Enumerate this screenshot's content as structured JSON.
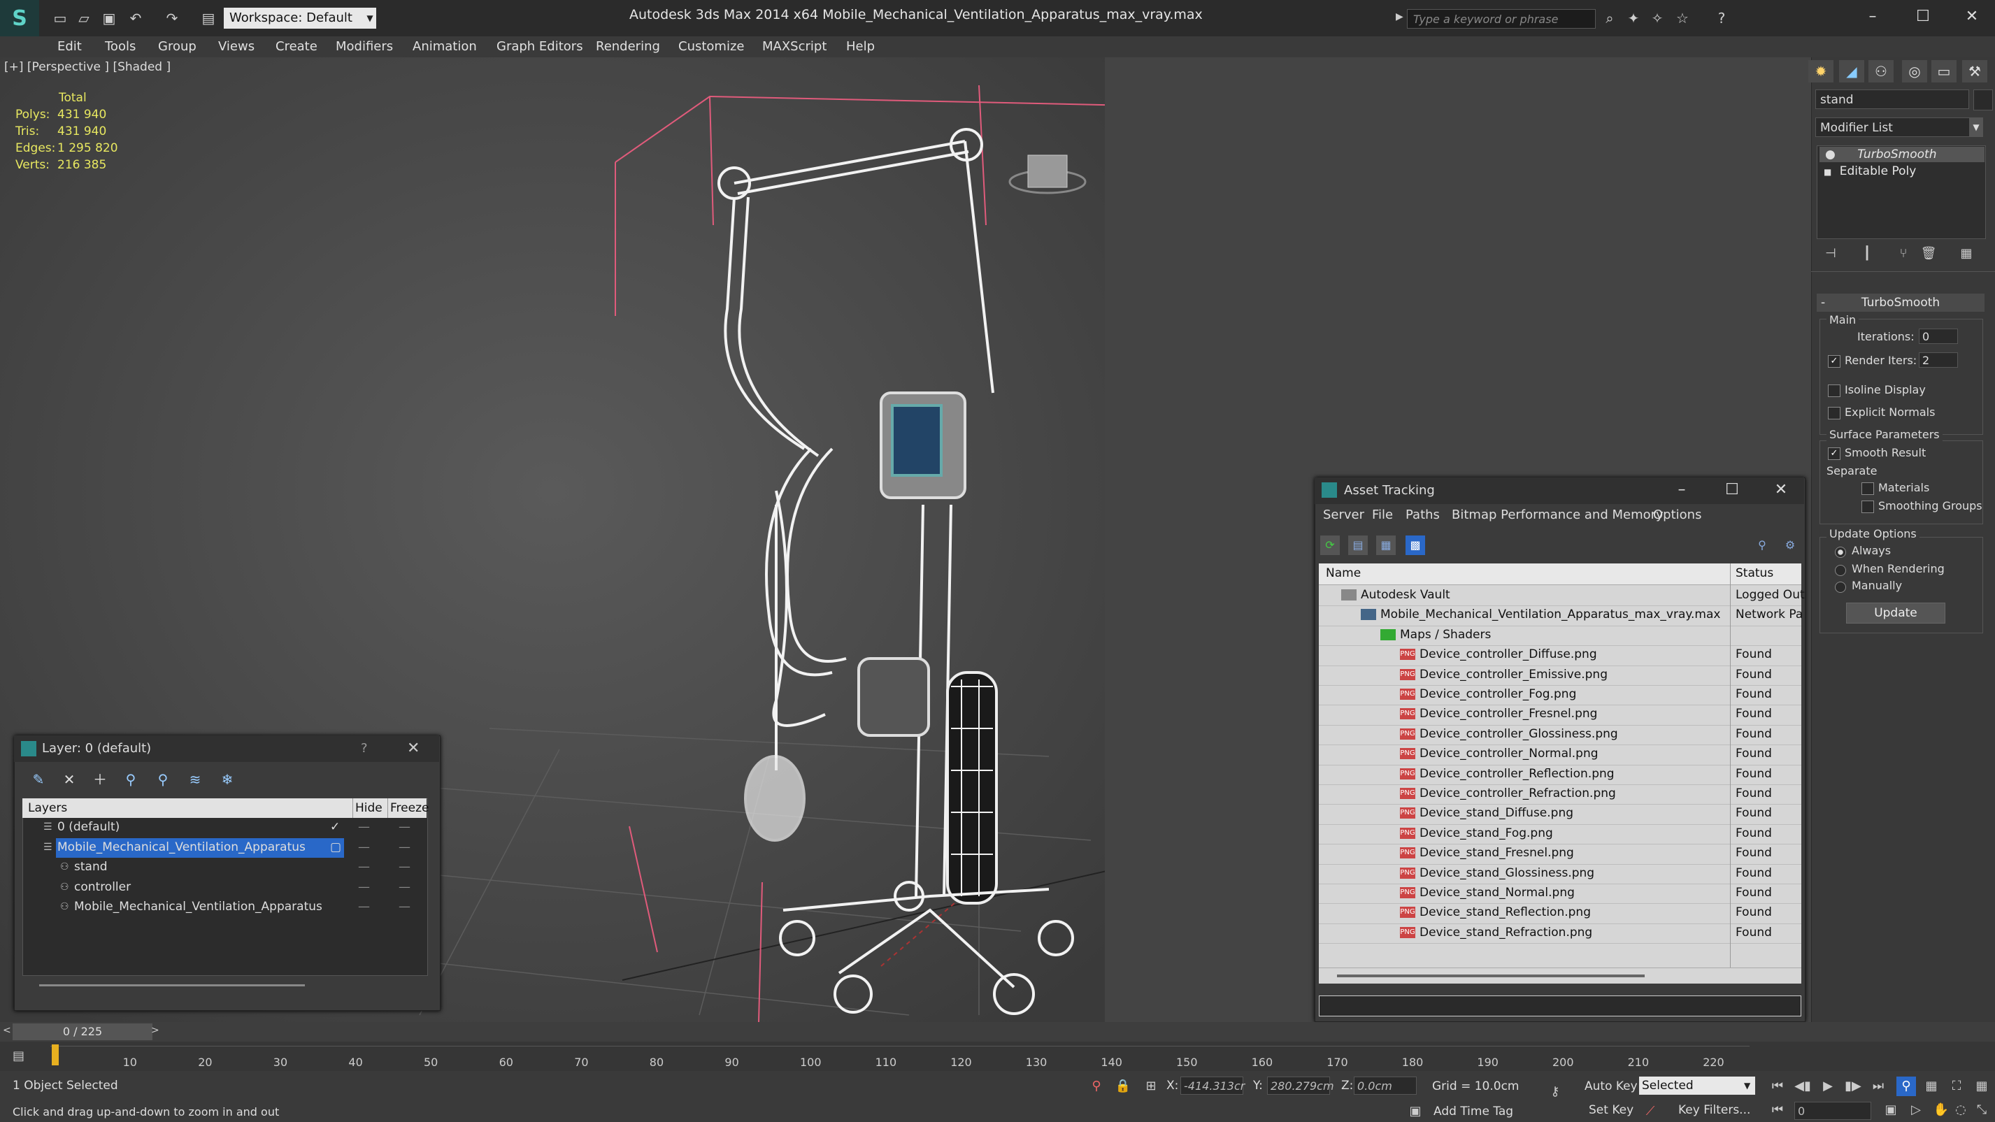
{
  "titlebar": {
    "workspace_label": "Workspace: Default",
    "app_title": "Autodesk 3ds Max  2014 x64     Mobile_Mechanical_Ventilation_Apparatus_max_vray.max",
    "search_placeholder": "Type a keyword or phrase"
  },
  "menu": [
    "Edit",
    "Tools",
    "Group",
    "Views",
    "Create",
    "Modifiers",
    "Animation",
    "Graph Editors",
    "Rendering",
    "Customize",
    "MAXScript",
    "Help"
  ],
  "viewport": {
    "label": "[+] [Perspective ] [Shaded ]",
    "stats": {
      "total_label": "Total",
      "polys_label": "Polys:",
      "polys": "431 940",
      "tris_label": "Tris:",
      "tris": "431 940",
      "edges_label": "Edges:",
      "edges": "1 295 820",
      "verts_label": "Verts:",
      "verts": "216 385"
    }
  },
  "command_panel": {
    "object_name": "stand",
    "modifier_list": "Modifier List",
    "stack": [
      "TurboSmooth",
      "Editable Poly"
    ],
    "turbosmooth": {
      "title": "TurboSmooth",
      "main_label": "Main",
      "iterations_label": "Iterations:",
      "iterations": "0",
      "render_iters_label": "Render Iters:",
      "render_iters": "2",
      "isoline_label": "Isoline Display",
      "explicit_normals_label": "Explicit Normals",
      "surface_params_label": "Surface Parameters",
      "smooth_result_label": "Smooth Result",
      "separate_label": "Separate",
      "materials_label": "Materials",
      "smoothing_groups_label": "Smoothing Groups",
      "update_options_label": "Update Options",
      "always_label": "Always",
      "when_rendering_label": "When Rendering",
      "manually_label": "Manually",
      "update_button": "Update"
    }
  },
  "asset_tracking": {
    "title": "Asset Tracking",
    "menu": [
      "Server",
      "File",
      "Paths",
      "Bitmap Performance and Memory",
      "Options"
    ],
    "col_name": "Name",
    "col_status": "Status",
    "rows": [
      {
        "name": "Autodesk Vault",
        "status": "Logged Out",
        "indent": 1,
        "icon": "vault"
      },
      {
        "name": "Mobile_Mechanical_Ventilation_Apparatus_max_vray.max",
        "status": "Network Pa",
        "indent": 2,
        "icon": "max"
      },
      {
        "name": "Maps / Shaders",
        "status": "",
        "indent": 3,
        "icon": "folder"
      },
      {
        "name": "Device_controller_Diffuse.png",
        "status": "Found",
        "indent": 4,
        "icon": "png"
      },
      {
        "name": "Device_controller_Emissive.png",
        "status": "Found",
        "indent": 4,
        "icon": "png"
      },
      {
        "name": "Device_controller_Fog.png",
        "status": "Found",
        "indent": 4,
        "icon": "png"
      },
      {
        "name": "Device_controller_Fresnel.png",
        "status": "Found",
        "indent": 4,
        "icon": "png"
      },
      {
        "name": "Device_controller_Glossiness.png",
        "status": "Found",
        "indent": 4,
        "icon": "png"
      },
      {
        "name": "Device_controller_Normal.png",
        "status": "Found",
        "indent": 4,
        "icon": "png"
      },
      {
        "name": "Device_controller_Reflection.png",
        "status": "Found",
        "indent": 4,
        "icon": "png"
      },
      {
        "name": "Device_controller_Refraction.png",
        "status": "Found",
        "indent": 4,
        "icon": "png"
      },
      {
        "name": "Device_stand_Diffuse.png",
        "status": "Found",
        "indent": 4,
        "icon": "png"
      },
      {
        "name": "Device_stand_Fog.png",
        "status": "Found",
        "indent": 4,
        "icon": "png"
      },
      {
        "name": "Device_stand_Fresnel.png",
        "status": "Found",
        "indent": 4,
        "icon": "png"
      },
      {
        "name": "Device_stand_Glossiness.png",
        "status": "Found",
        "indent": 4,
        "icon": "png"
      },
      {
        "name": "Device_stand_Normal.png",
        "status": "Found",
        "indent": 4,
        "icon": "png"
      },
      {
        "name": "Device_stand_Reflection.png",
        "status": "Found",
        "indent": 4,
        "icon": "png"
      },
      {
        "name": "Device_stand_Refraction.png",
        "status": "Found",
        "indent": 4,
        "icon": "png"
      }
    ]
  },
  "layer_dialog": {
    "title": "Layer: 0 (default)",
    "help": "?",
    "col_layers": "Layers",
    "col_hide": "Hide",
    "col_freeze": "Freeze",
    "rows": [
      {
        "name": "0 (default)",
        "indent": 1,
        "selected": false,
        "check": "✓"
      },
      {
        "name": "Mobile_Mechanical_Ventilation_Apparatus",
        "indent": 1,
        "selected": true,
        "check": "▢"
      },
      {
        "name": "stand",
        "indent": 2,
        "selected": false,
        "check": ""
      },
      {
        "name": "controller",
        "indent": 2,
        "selected": false,
        "check": ""
      },
      {
        "name": "Mobile_Mechanical_Ventilation_Apparatus",
        "indent": 2,
        "selected": false,
        "check": ""
      }
    ]
  },
  "timeline": {
    "position": "0 / 225",
    "ticks": [
      "10",
      "20",
      "30",
      "40",
      "50",
      "60",
      "70",
      "80",
      "90",
      "100",
      "110",
      "120",
      "130",
      "140",
      "150",
      "160",
      "170",
      "180",
      "190",
      "200",
      "210",
      "220"
    ]
  },
  "status": {
    "selection": "1 Object Selected",
    "prompt": "Click and drag up-and-down to zoom in and out",
    "x_label": "X:",
    "x": "-414.313cr",
    "y_label": "Y:",
    "y": "280.279cm",
    "z_label": "Z:",
    "z": "0.0cm",
    "grid": "Grid = 10.0cm",
    "auto_key": "Auto Key",
    "set_key": "Set Key",
    "selected": "Selected",
    "key_filters": "Key Filters...",
    "add_time_tag": "Add Time Tag",
    "frame": "0"
  }
}
